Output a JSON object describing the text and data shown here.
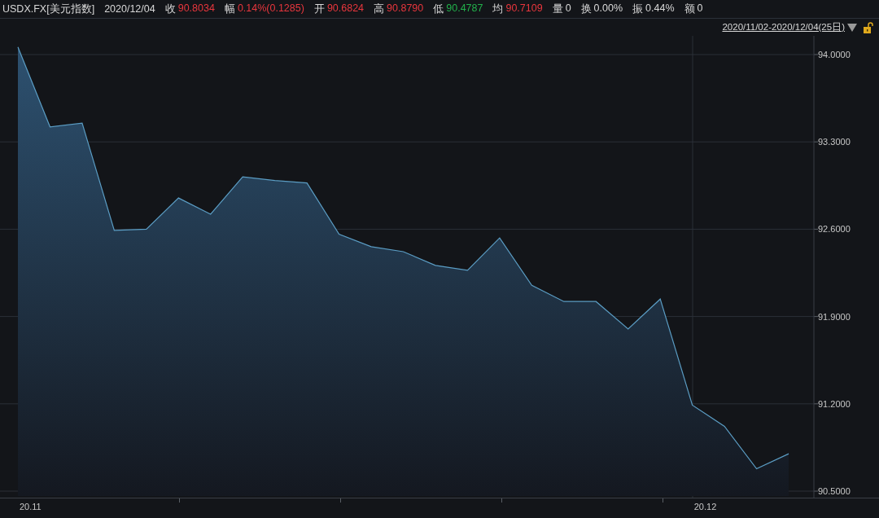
{
  "quote_bar": {
    "symbol": "USDX.FX[美元指数]",
    "date": "2020/12/04",
    "fields": [
      {
        "label": "收",
        "value": "90.8034",
        "color": "#e8363d"
      },
      {
        "label": "幅",
        "value": "0.14%(0.1285)",
        "color": "#e8363d"
      },
      {
        "label": "开",
        "value": "90.6824",
        "color": "#e8363d"
      },
      {
        "label": "高",
        "value": "90.8790",
        "color": "#e8363d"
      },
      {
        "label": "低",
        "value": "90.4787",
        "color": "#22b04b"
      },
      {
        "label": "均",
        "value": "90.7109",
        "color": "#e8363d"
      },
      {
        "label": "量",
        "value": "0",
        "color": "#d8d8d8"
      },
      {
        "label": "换",
        "value": "0.00%",
        "color": "#d8d8d8"
      },
      {
        "label": "振",
        "value": "0.44%",
        "color": "#d8d8d8"
      },
      {
        "label": "额",
        "value": "0",
        "color": "#d8d8d8"
      }
    ]
  },
  "range_bar": {
    "range": "2020/11/02-2020/12/04(25日)",
    "locked": false
  },
  "chart": {
    "chart_data": {
      "type": "area",
      "grid": true,
      "values": [
        94.06,
        93.42,
        93.45,
        92.59,
        92.6,
        92.85,
        92.72,
        93.02,
        92.99,
        92.97,
        92.56,
        92.46,
        92.42,
        92.31,
        92.27,
        92.53,
        92.15,
        92.02,
        92.02,
        91.8,
        92.04,
        91.19,
        91.02,
        90.68,
        90.8
      ],
      "ylim": [
        90.448,
        94.15
      ],
      "yticks": [
        {
          "value": 94.0,
          "label": "94.0000"
        },
        {
          "value": 93.3,
          "label": "93.3000"
        },
        {
          "value": 92.6,
          "label": "92.6000"
        },
        {
          "value": 91.9,
          "label": "91.9000"
        },
        {
          "value": 91.2,
          "label": "91.2000"
        },
        {
          "value": 90.5,
          "label": "90.5000"
        }
      ]
    },
    "x_axis_labels": [
      "20.11",
      "20.12"
    ]
  }
}
